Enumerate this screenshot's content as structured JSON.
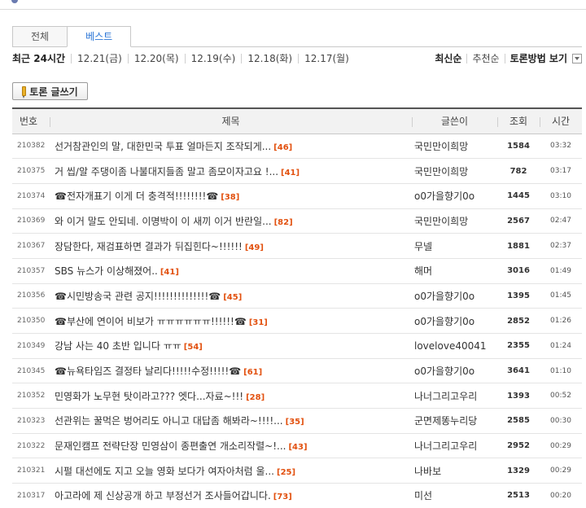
{
  "tabs": [
    {
      "label": "전체",
      "active": false
    },
    {
      "label": "베스트",
      "active": true
    }
  ],
  "periods": [
    "최근 24시간",
    "12.21(금)",
    "12.20(목)",
    "12.19(수)",
    "12.18(화)",
    "12.17(월)"
  ],
  "sorts": {
    "latest": "최신순",
    "recommend": "추천순",
    "view_mode": "토론방법 보기"
  },
  "write_button": "토론 글쓰기",
  "columns": {
    "no": "번호",
    "title": "제목",
    "author": "글쓴이",
    "views": "조회",
    "time": "시간"
  },
  "rows": [
    {
      "no": "210382",
      "title": "선거참관인의 말, 대한민국 투표 얼마든지 조작되게...",
      "comments": "[46]",
      "author": "국민만이희망",
      "views": "1584",
      "time": "03:32"
    },
    {
      "no": "210375",
      "title": "거 씹/알 주댕이좀 나불대지들좀 말고 좀모이자고요 !...",
      "comments": "[41]",
      "author": "국민만이희망",
      "views": "782",
      "time": "03:17"
    },
    {
      "no": "210374",
      "title": "☎전자개표기 이게 더 충격적!!!!!!!!☎",
      "comments": "[38]",
      "author": "o0가을향기0o",
      "views": "1445",
      "time": "03:10"
    },
    {
      "no": "210369",
      "title": "와 이거 말도 안되네. 이명박이 이 새끼 이거 반란일...",
      "comments": "[82]",
      "author": "국민만이희망",
      "views": "2567",
      "time": "02:47"
    },
    {
      "no": "210367",
      "title": "장담한다, 재검표하면 결과가 뒤집힌다~!!!!!!",
      "comments": "[49]",
      "author": "무넬",
      "views": "1881",
      "time": "02:37"
    },
    {
      "no": "210357",
      "title": "SBS 뉴스가 이상해졌어..",
      "comments": "[41]",
      "author": "해머",
      "views": "3016",
      "time": "01:49"
    },
    {
      "no": "210356",
      "title": "☎시민방송국 관련 공지!!!!!!!!!!!!!!☎",
      "comments": "[45]",
      "author": "o0가을향기0o",
      "views": "1395",
      "time": "01:45"
    },
    {
      "no": "210350",
      "title": "☎부산에 연이어 비보가 ㅠㅠㅠㅠㅠㅠ!!!!!!☎",
      "comments": "[31]",
      "author": "o0가을향기0o",
      "views": "2852",
      "time": "01:26"
    },
    {
      "no": "210349",
      "title": "강남 사는 40 초반 입니다 ㅠㅠ",
      "comments": "[54]",
      "author": "lovelove40041",
      "views": "2355",
      "time": "01:24"
    },
    {
      "no": "210345",
      "title": "☎뉴욕타임즈 결정타 날리다!!!!!수정!!!!!☎",
      "comments": "[61]",
      "author": "o0가을향기0o",
      "views": "3641",
      "time": "01:10"
    },
    {
      "no": "210352",
      "title": "민영화가 노무현 탓이라고??? 엣다...자료~!!!",
      "comments": "[28]",
      "author": "나너그리고우리",
      "views": "1393",
      "time": "00:52"
    },
    {
      "no": "210323",
      "title": "선관위는 꿀먹은 벙어리도 아니고 대답좀 해봐라~!!!!...",
      "comments": "[35]",
      "author": "군면제똥누리당",
      "views": "2585",
      "time": "00:30"
    },
    {
      "no": "210322",
      "title": "문재인캠프 전략단장 민영삼이 종편출연 개소리작렬~!...",
      "comments": "[43]",
      "author": "나너그리고우리",
      "views": "2952",
      "time": "00:29"
    },
    {
      "no": "210321",
      "title": "시펄 대선에도 지고 오늘 영화 보다가 여자아처럼 울...",
      "comments": "[25]",
      "author": "나바보",
      "views": "1329",
      "time": "00:29"
    },
    {
      "no": "210317",
      "title": "아고라에 제 신상공개 하고 부정선거 조사들어갑니다.",
      "comments": "[73]",
      "author": "미선",
      "views": "2513",
      "time": "00:20"
    }
  ]
}
